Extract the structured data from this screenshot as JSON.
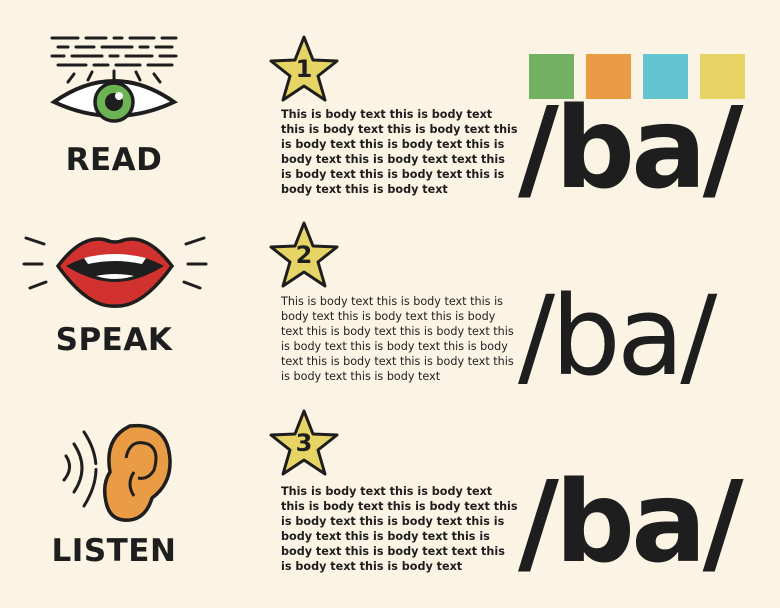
{
  "colors": {
    "background": "#fbf3e4",
    "swatches": [
      "#72b062",
      "#ea9c45",
      "#64c4cf",
      "#e6d565"
    ],
    "star": "#e6d565",
    "eye_iris": "#6cb453",
    "lips": "#d1322f",
    "ear": "#ea9c45"
  },
  "rows": [
    {
      "icon": "eye-icon",
      "label": "READ",
      "number": "1",
      "text": "This is body text this is body text this is body text this is body text this is body text this is body text this is body text this is body text text this is body text this is body text this is body text this is body text",
      "phoneme": "/ba/"
    },
    {
      "icon": "lips-icon",
      "label": "SPEAK",
      "number": "2",
      "text": "This is body text this is body text this is body text this is body text this is body text this is body text this is body text this is body text this is body text this is body text this is body text this is body text this is body text this is body text",
      "phoneme": "/ba/"
    },
    {
      "icon": "ear-icon",
      "label": "LISTEN",
      "number": "3",
      "text": "This is body text this is body text this is body text this is body text this is body text this is body text this is body text this is body text this is body text this is body text text this is body text this is body text",
      "phoneme": "/ba/"
    }
  ]
}
